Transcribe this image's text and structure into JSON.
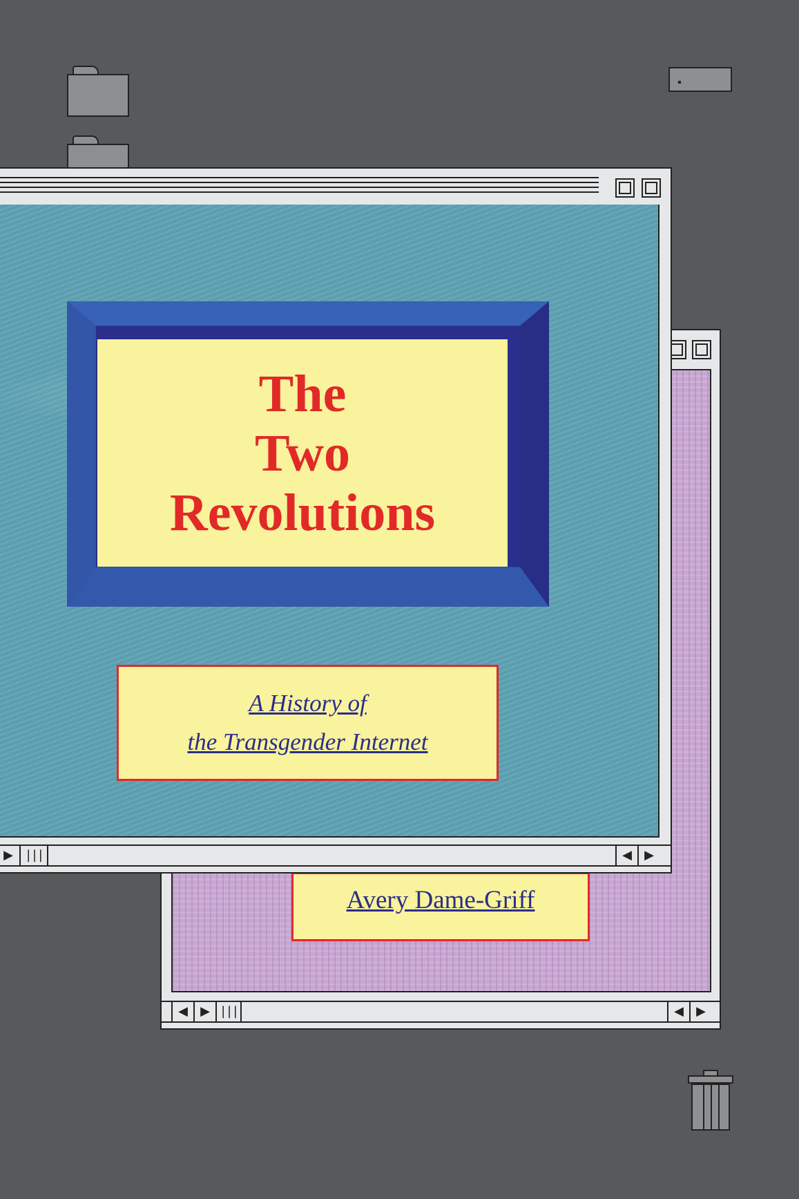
{
  "cover": {
    "title_lines": [
      "The",
      "Two",
      "Revolutions"
    ],
    "subtitle_lines": [
      "A History of",
      "the Transgender Internet"
    ],
    "author": "Avery Dame-Griff"
  },
  "icons": {
    "folder": "folder-icon",
    "drive": "hard-drive-icon",
    "trash": "trash-icon",
    "scroll_left": "arrow-left-icon",
    "scroll_right": "arrow-right-icon",
    "grip": "scroll-grip-icon",
    "window_buttons": "window-control-icon"
  },
  "colors": {
    "desktop": "#58595b",
    "window_chrome": "#e6e7e8",
    "front_window_content": "#5fa3b4",
    "back_window_content": "#c7a6d1",
    "frame_blue": "#3356a8",
    "panel_yellow": "#f8f39c",
    "title_red": "#e12a27",
    "text_navy": "#2b2e86"
  }
}
